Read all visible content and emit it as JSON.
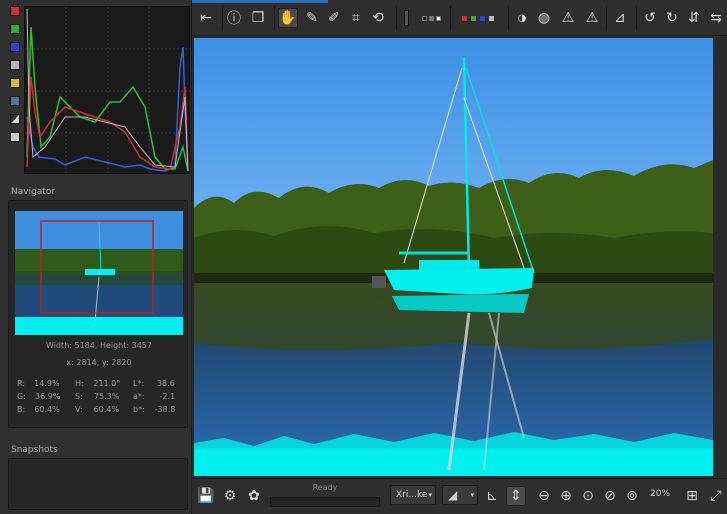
{
  "navigator": {
    "title": "Navigator",
    "dimensions": "Width: 5184, Height: 3457",
    "coords": "x: 2814, y: 2820",
    "rgb": [
      {
        "label": "R:",
        "value": "14.9%"
      },
      {
        "label": "G:",
        "value": "36.9%"
      },
      {
        "label": "B:",
        "value": "60.4%"
      }
    ],
    "hsv": [
      {
        "label": "H:",
        "value": "211.0°"
      },
      {
        "label": "S:",
        "value": "75.3%"
      },
      {
        "label": "V:",
        "value": "60.4%"
      }
    ],
    "lab": [
      {
        "label": "L*:",
        "value": "38.6"
      },
      {
        "label": "a*:",
        "value": "-2.1"
      },
      {
        "label": "b*:",
        "value": "-38.8"
      }
    ]
  },
  "snapshots": {
    "title": "Snapshots"
  },
  "status": {
    "text": "Ready"
  },
  "zoom": {
    "mode": "Xri...ke",
    "level": "20%"
  },
  "histogram_buttons": [
    {
      "name": "red-channel",
      "color": "#d03030"
    },
    {
      "name": "green-channel",
      "color": "#30b030"
    },
    {
      "name": "blue-channel",
      "color": "#3040d0"
    },
    {
      "name": "luminance-channel",
      "color": "#b8b8b8"
    },
    {
      "name": "chroma-channel",
      "color": "#d8c020"
    },
    {
      "name": "raw-channel",
      "color": "#4a7a9a"
    }
  ],
  "colors": {
    "accent": "#2f6fc0",
    "sky": "#3f8fe0",
    "clipped": "#00f0f0"
  }
}
